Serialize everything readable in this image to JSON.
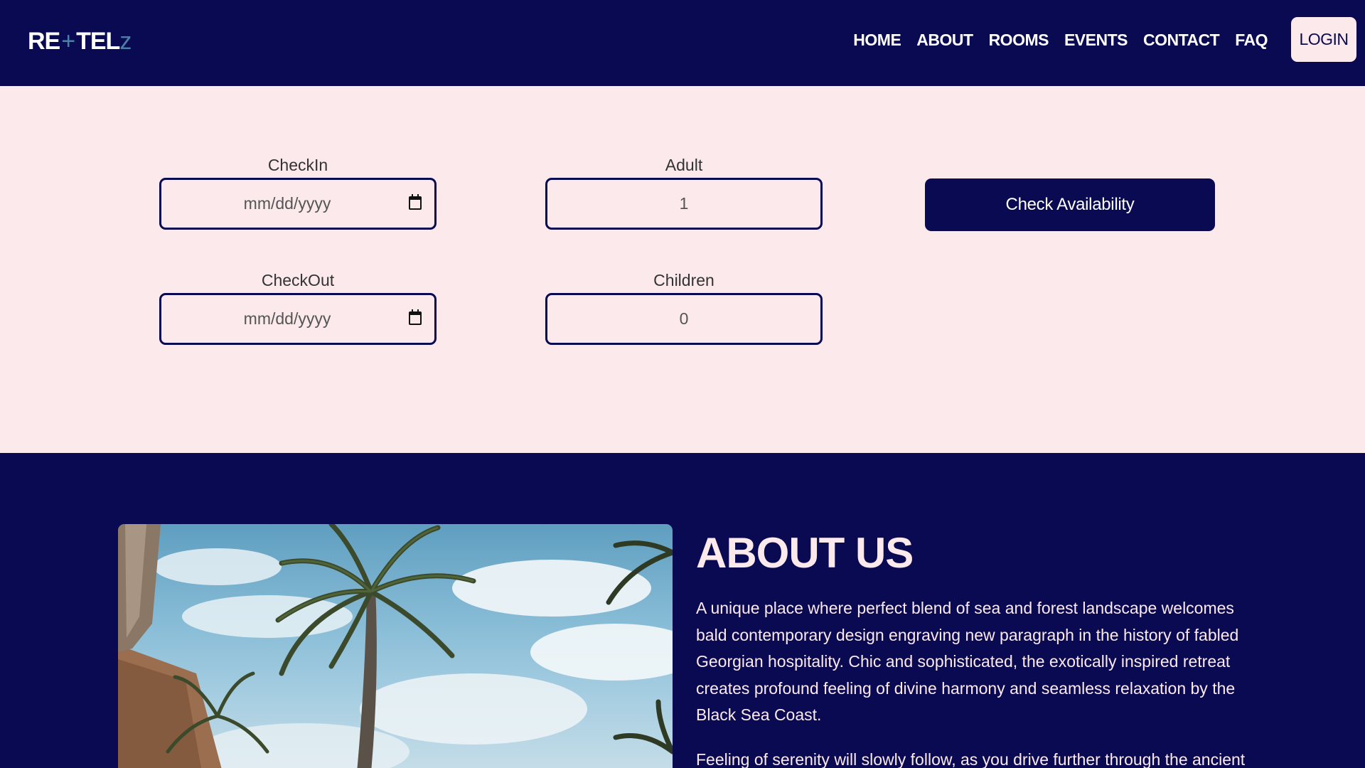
{
  "brand": {
    "logo_part1": "RE",
    "logo_plus": "+",
    "logo_part2": "TEL",
    "logo_z": "z"
  },
  "nav": {
    "links": [
      "HOME",
      "ABOUT",
      "ROOMS",
      "EVENTS",
      "CONTACT",
      "FAQ"
    ],
    "login_label": "LOGIN"
  },
  "booking": {
    "checkin": {
      "label": "CheckIn",
      "placeholder": "mm/dd/yyyy"
    },
    "checkout": {
      "label": "CheckOut",
      "placeholder": "mm/dd/yyyy"
    },
    "adult": {
      "label": "Adult",
      "value": "1"
    },
    "children": {
      "label": "Children",
      "value": "0"
    },
    "submit_label": "Check Availability"
  },
  "about": {
    "title": "ABOUT US",
    "paragraph1": "A unique place where perfect blend of sea and forest landscape welcomes bald contemporary design engraving new paragraph in the history of fabled Georgian hospitality. Chic and sophisticated, the exotically inspired retreat creates profound feeling of divine harmony and seamless relaxation by the Black Sea Coast.",
    "paragraph2": "Feeling of serenity will slowly follow, as you drive further through the ancient"
  },
  "colors": {
    "navy": "#0a0a52",
    "blush": "#fbe9ec"
  }
}
